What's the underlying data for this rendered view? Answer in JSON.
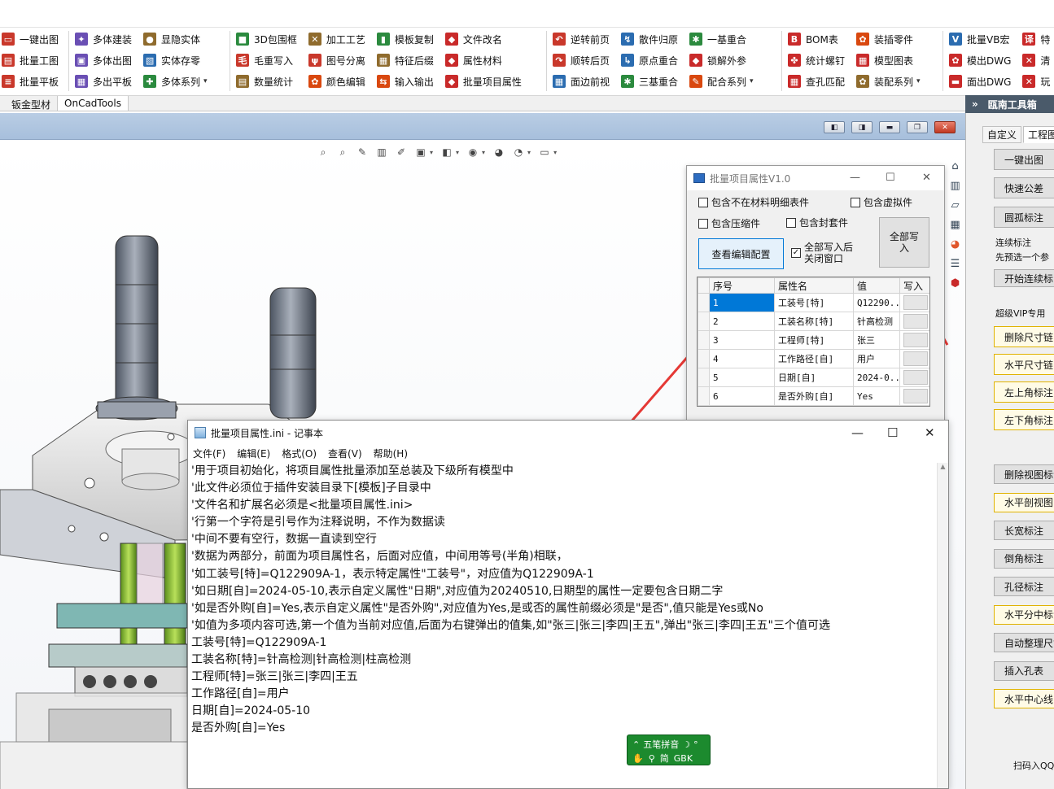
{
  "ribbon": {
    "groups": [
      {
        "items": [
          {
            "label": "一键出图",
            "icon": "one-click-drawing-icon",
            "color": "#c9382b"
          },
          {
            "label": "批量工图",
            "icon": "batch-drawing-icon",
            "color": "#c9382b"
          },
          {
            "label": "批量平板",
            "icon": "batch-flat-icon",
            "color": "#c9382b"
          }
        ]
      },
      {
        "items": [
          {
            "label": "多体建装",
            "icon": "multibody-assembly-icon",
            "color": "#6a4fb4"
          },
          {
            "label": "多体出图",
            "icon": "multibody-drawing-icon",
            "color": "#6a4fb4"
          },
          {
            "label": "多出平板",
            "icon": "multi-flat-icon",
            "color": "#6a4fb4"
          },
          {
            "label": "显隐实体",
            "icon": "show-hide-body-icon",
            "color": "#8f6b2d"
          },
          {
            "label": "实体存零",
            "icon": "save-body-part-icon",
            "color": "#2b6cb0"
          },
          {
            "label": "多体系列",
            "icon": "multibody-series-icon",
            "color": "#2b8a3e",
            "dropdown": true
          }
        ]
      },
      {
        "items": [
          {
            "label": "3D包围框",
            "icon": "bounding-box-icon",
            "color": "#2b8a3e"
          },
          {
            "label": "毛重写入",
            "icon": "gross-weight-icon",
            "color": "#c9382b"
          },
          {
            "label": "数量统计",
            "icon": "quantity-stats-icon",
            "color": "#8f6b2d"
          },
          {
            "label": "加工工艺",
            "icon": "machining-process-icon",
            "color": "#8f6b2d"
          },
          {
            "label": "图号分离",
            "icon": "drawing-number-split-icon",
            "color": "#c9382b"
          },
          {
            "label": "颜色编辑",
            "icon": "color-edit-icon",
            "color": "#d9480f"
          },
          {
            "label": "模板复制",
            "icon": "template-copy-icon",
            "color": "#2b8a3e"
          },
          {
            "label": "特征后缀",
            "icon": "feature-suffix-icon",
            "color": "#8f6b2d"
          },
          {
            "label": "输入输出",
            "icon": "input-output-icon",
            "color": "#d9480f"
          },
          {
            "label": "文件改名",
            "icon": "file-rename-icon",
            "color": "#c92a2a"
          },
          {
            "label": "属性材料",
            "icon": "property-material-icon",
            "color": "#c92a2a"
          },
          {
            "label": "批量项目属性",
            "icon": "batch-project-props-icon",
            "color": "#c92a2a"
          }
        ]
      },
      {
        "items": [
          {
            "label": "逆转前页",
            "icon": "reverse-front-icon",
            "color": "#c9382b"
          },
          {
            "label": "顺转后页",
            "icon": "forward-back-icon",
            "color": "#c9382b"
          },
          {
            "label": "面边前视",
            "icon": "face-edge-front-icon",
            "color": "#2b6cb0"
          },
          {
            "label": "散件归原",
            "icon": "parts-restore-icon",
            "color": "#2b6cb0"
          },
          {
            "label": "原点重合",
            "icon": "origin-coincide-icon",
            "color": "#2b6cb0"
          },
          {
            "label": "三基重合",
            "icon": "three-base-coincide-icon",
            "color": "#2b8a3e"
          },
          {
            "label": "一基重合",
            "icon": "one-base-coincide-icon",
            "color": "#2b8a3e"
          },
          {
            "label": "锁解外参",
            "icon": "lock-external-ref-icon",
            "color": "#c92a2a"
          },
          {
            "label": "配合系列",
            "icon": "mate-series-icon",
            "color": "#d9480f",
            "dropdown": true
          }
        ]
      },
      {
        "items": [
          {
            "label": "BOM表",
            "icon": "bom-icon",
            "color": "#c92a2a"
          },
          {
            "label": "统计螺钉",
            "icon": "screw-stats-icon",
            "color": "#c92a2a"
          },
          {
            "label": "查孔匹配",
            "icon": "hole-match-icon",
            "color": "#c92a2a"
          },
          {
            "label": "装插零件",
            "icon": "insert-part-icon",
            "color": "#d9480f"
          },
          {
            "label": "模型图表",
            "icon": "model-chart-icon",
            "color": "#c92a2a"
          },
          {
            "label": "装配系列",
            "icon": "assembly-series-icon",
            "color": "#8f6b2d",
            "dropdown": true
          }
        ]
      },
      {
        "items": [
          {
            "label": "批量VB宏",
            "icon": "vba-macro-icon",
            "color": "#2b6cb0"
          },
          {
            "label": "模出DWG",
            "icon": "model-dwg-icon",
            "color": "#c92a2a"
          },
          {
            "label": "面出DWG",
            "icon": "face-dwg-icon",
            "color": "#c92a2a"
          },
          {
            "label": "特",
            "icon": "special-icon",
            "color": "#c92a2a"
          },
          {
            "label": "清",
            "icon": "clear-icon",
            "color": "#c92a2a"
          },
          {
            "label": "玩",
            "icon": "play-icon",
            "color": "#c92a2a"
          }
        ]
      }
    ],
    "glyphs": {
      "g0": [
        "▭",
        "▤",
        "≡"
      ],
      "g1": [
        "✦",
        "▣",
        "▦",
        "●",
        "▧",
        "✚"
      ],
      "g2": [
        "■",
        "毛",
        "▤",
        "✕",
        "ψ",
        "✿",
        "▮",
        "▦",
        "⇆",
        "◆",
        "◆",
        "◆"
      ],
      "g3": [
        "↶",
        "↷",
        "▦",
        "↯",
        "↳",
        "✱",
        "✱",
        "◆",
        "✎"
      ],
      "g4": [
        "B",
        "✤",
        "▦",
        "✿",
        "▦",
        "✿"
      ],
      "g5": [
        "V",
        "✿",
        "▬",
        "译",
        "✕",
        "✕"
      ]
    }
  },
  "tabs": [
    "钣金型材",
    "OnCadTools"
  ],
  "right_panel": {
    "title": "瓯南工具箱",
    "chevron": "»",
    "tabs": [
      "自定义",
      "工程图"
    ],
    "buttons_top": [
      "一键出图",
      "快速公差",
      "圆孤标注"
    ],
    "continuous_label": "连续标注",
    "continuous_hint": "先预选一个参",
    "start_continuous": "开始连续标",
    "vip_label": "超级VIP专用",
    "vip_buttons": [
      "删除尺寸链",
      "水平尺寸链",
      "左上角标注",
      "左下角标注"
    ],
    "buttons_bottom": [
      "删除视图标注",
      "水平剖视图",
      "长宽标注",
      "倒角标注",
      "孔径标注",
      "水平分中标注",
      "自动整理尺寸",
      "插入孔表",
      "水平中心线"
    ],
    "footer": "扫码入QQ"
  },
  "dialog": {
    "title": "批量项目属性V1.0",
    "checkboxes": [
      {
        "label": "包含不在材料明细表件",
        "checked": false
      },
      {
        "label": "包含虚拟件",
        "checked": false
      },
      {
        "label": "包含压缩件",
        "checked": false
      },
      {
        "label": "包含封套件",
        "checked": false
      }
    ],
    "config_button": "查看编辑配置",
    "close_after": {
      "label_line1": "全部写入后",
      "label_line2": "关闭窗口",
      "checked": true
    },
    "write_all_button": "全部写入",
    "table": {
      "headers": [
        "序号",
        "属性名",
        "值",
        "写入"
      ],
      "rows": [
        {
          "no": "1",
          "name": "工装号[特]",
          "value": "Q12290..."
        },
        {
          "no": "2",
          "name": "工装名称[特]",
          "value": "针高检测"
        },
        {
          "no": "3",
          "name": "工程师[特]",
          "value": "张三"
        },
        {
          "no": "4",
          "name": "工作路径[自]",
          "value": "用户"
        },
        {
          "no": "5",
          "name": "日期[自]",
          "value": "2024-0..."
        },
        {
          "no": "6",
          "name": "是否外购[自]",
          "value": "Yes"
        }
      ]
    }
  },
  "notepad": {
    "title": "批量项目属性.ini - 记事本",
    "menus": [
      "文件(F)",
      "编辑(E)",
      "格式(O)",
      "查看(V)",
      "帮助(H)"
    ],
    "lines": [
      "'用于项目初始化，将项目属性批量添加至总装及下级所有模型中",
      "'此文件必须位于插件安装目录下[模板]子目录中",
      "'文件名和扩展名必须是<批量项目属性.ini>",
      "'行第一个字符是引号作为注释说明，不作为数据读",
      "'中间不要有空行，数据一直读到空行",
      "'数据为两部分，前面为项目属性名，后面对应值，中间用等号(半角)相联，",
      "'如工装号[特]=Q122909A-1，表示特定属性\"工装号\"，对应值为Q122909A-1",
      "'如日期[自]=2024-05-10,表示自定义属性\"日期\",对应值为20240510,日期型的属性一定要包含日期二字",
      "'如是否外购[自]=Yes,表示自定义属性\"是否外购\",对应值为Yes,是或否的属性前缀必须是\"是否\",值只能是Yes或No",
      "'如值为多项内容可选,第一个值为当前对应值,后面为右键弹出的值集,如\"张三|张三|李四|王五\",弹出\"张三|李四|王五\"三个值可选",
      "工装号[特]=Q122909A-1",
      "工装名称[特]=针高检测|针高检测|柱高检测",
      "工程师[特]=张三|张三|李四|王五",
      "工作路径[自]=用户",
      "日期[自]=2024-05-10",
      "是否外购[自]=Yes"
    ]
  },
  "ime": {
    "name": "五笔拼音",
    "mode": "简",
    "charset": "GBK"
  },
  "colors": {
    "arrow": "#e53935",
    "selection": "#0078d7",
    "rpanel_header": "#4a5a6a"
  }
}
